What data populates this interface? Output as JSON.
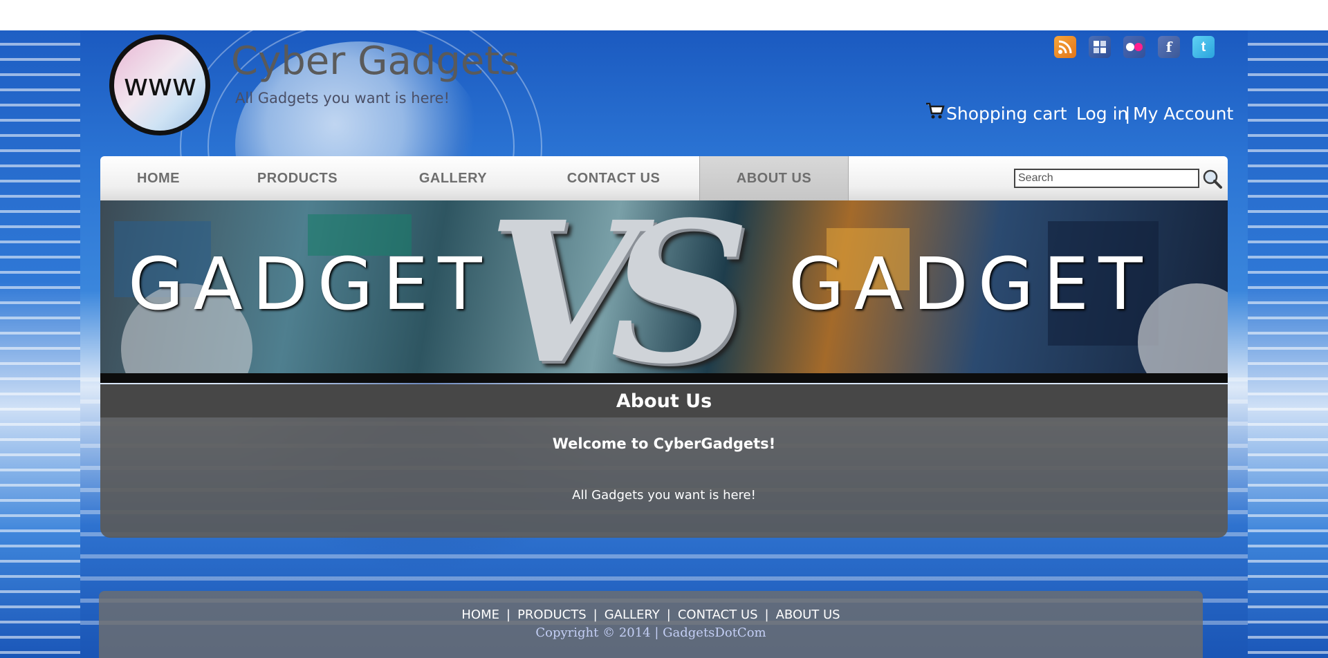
{
  "site": {
    "logo_text": "www",
    "title": "Cyber Gadgets",
    "tagline": "All Gadgets you want is here!"
  },
  "header": {
    "social_icons": [
      "rss-icon",
      "delicious-icon",
      "flickr-icon",
      "facebook-icon",
      "twitter-icon"
    ],
    "cart_label": "Shopping cart",
    "login_label": "Log in",
    "separator": "|",
    "account_label": "My Account"
  },
  "nav": {
    "items": [
      {
        "label": "HOME"
      },
      {
        "label": "PRODUCTS"
      },
      {
        "label": "GALLERY"
      },
      {
        "label": "CONTACT US"
      },
      {
        "label": "ABOUT US",
        "active": true
      }
    ],
    "search_placeholder": "Search"
  },
  "banner": {
    "left_text": "GADGET",
    "vs_text": "VS",
    "right_text": "GADGET"
  },
  "content": {
    "heading": "About Us",
    "welcome": "Welcome to CyberGadgets!",
    "body": "All Gadgets you want is here!"
  },
  "footer": {
    "links": [
      "HOME",
      "PRODUCTS",
      "GALLERY",
      "CONTACT US",
      "ABOUT US"
    ],
    "separator": "|",
    "copyright": "Copyright © 2014 | GadgetsDotCom"
  },
  "colors": {
    "page_blue": "#2b74d4",
    "nav_text": "#6e6e6e",
    "content_panel": "#5a5a5a",
    "content_header": "#474747",
    "copyright_text": "#c4cff5"
  }
}
